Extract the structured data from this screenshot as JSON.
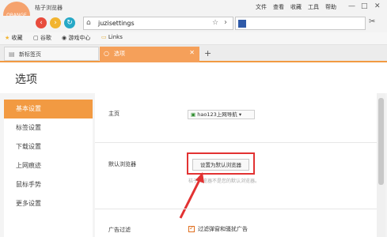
{
  "window": {
    "logo_text": "ORANGE",
    "title": "桔子浏览器",
    "menus": [
      "文件",
      "查看",
      "收藏",
      "工具",
      "帮助"
    ],
    "controls": [
      "—",
      "□",
      "✕"
    ]
  },
  "navbar": {
    "url": "juzisettings",
    "search_placeholder": ""
  },
  "bookmarks": [
    "收藏",
    "谷歌",
    "游戏中心",
    "Links"
  ],
  "tabs": [
    {
      "label": "新标签页",
      "active": false
    },
    {
      "label": "选项",
      "active": true
    }
  ],
  "page": {
    "title": "选项",
    "sidebar": [
      "基本设置",
      "标签设置",
      "下载设置",
      "上网痕迹",
      "鼠标手势",
      "更多设置"
    ],
    "active_sidebar": "基本设置",
    "sections": {
      "homepage_label": "主页",
      "homepage_value": "hao123上网导航",
      "default_label": "默认浏览器",
      "default_button": "设置为默认浏览器",
      "default_note": "桔子浏览器不是您的默认浏览器。",
      "ads_label": "广告过滤",
      "ads_checkbox": "过滤弹窗和骚扰广告",
      "ads_checked": true
    }
  },
  "colors": {
    "accent": "#f29a42",
    "highlight": "#e23232"
  }
}
